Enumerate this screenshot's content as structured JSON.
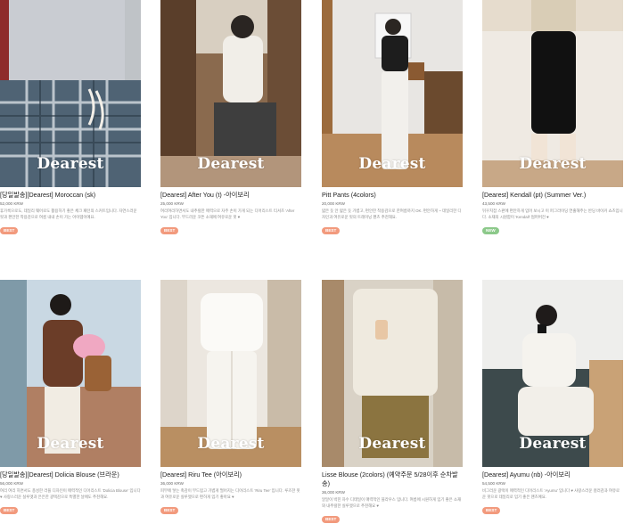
{
  "brand_wordmark": "Dearest",
  "products": [
    {
      "name": "[당일발송][Dearest] Moroccan (sk)",
      "price": "52,000 KRW",
      "desc": "휴가룩으로도, 데일리 웨어로도 활용하기 좋은 체크 패턴의 스커트입니다. 자연스러운 핏과 편안한 착용감으로 여름 내내 손이 가는 아이템이에요.",
      "badge": "BEST",
      "badge_color": "#f29a7d"
    },
    {
      "name": "[Dearest] After You (t) -아이보리",
      "price": "25,000 KRW",
      "desc": "여리여리하면서도 내추럴한 매력으로 자주 손이 가게 되는 디어리스트 티셔츠 'After You' 입니다. 부드러운 코튼 소재에 여유로운 핏 ♥",
      "badge": "BEST",
      "badge_color": "#f29a7d"
    },
    {
      "name": "Pitt Pants (4colors)",
      "price": "20,000 KRW",
      "desc": "얇은 듯 안 얇은 듯 가볍고, 편안한 착용감으로 한여름까지 OK. 편안하게 ~ 데일리한 디자인과 여유로운 핏의 트레이닝 팬츠 추천해요.",
      "badge": "BEST",
      "badge_color": "#f29a7d"
    },
    {
      "name": "[Dearest] Kendall (pt) (Summer Ver.)",
      "price": "43,500 KRW",
      "desc": "뒤꾸치잡 스판에 편안하게 입어 보시고 이 퍼그라이딩 연출해주는 반딩 바이커 쇼츠입니다. 소재의 시원함이 'Kendall' 썸머버전 ♥",
      "badge": "NEW",
      "badge_color": "#8cc98a"
    },
    {
      "name": "[당일발송][Dearest] Dolicia Blouse (브라운)",
      "price": "56,000 KRW",
      "desc": "여리 여리 하면서도 풍성한 러플 디자인이 매력적인 디어리스트 'Dolicia Blouse' 입니다 ♥ 사랑스러운 실루엣과 은은한 광택감으로 특별한 날에도 추천해요.",
      "badge": "BEST",
      "badge_color": "#f29a7d"
    },
    {
      "name": "[Dearest] Riru Tee (아이보리)",
      "price": "36,000 KRW",
      "desc": "피부에 닿는 촉감이 부드럽고 가볍게 떨어지는 디어리스트 'Riru Tee' 입니다. 루즈한 핏과 여유로운 실루엣으로 편하게 입기 좋아요 ♥",
      "badge": "BEST",
      "badge_color": "#f29a7d"
    },
    {
      "name": "Lisse Blouse (2colors) (예약주문 5/28이후 순차발송)",
      "price": "36,000 KRW",
      "desc": "알알이 박힌 자수 디테일이 매력적인 블라우스 입니다. 여름에 시원하게 입기 좋은 소재와 내추럴한 실루엣으로 추천해요 ♥",
      "badge": "BEST",
      "badge_color": "#f29a7d"
    },
    {
      "name": "[Dearest] Ayumu (nb) -아이보리",
      "price": "54,500 KRW",
      "desc": "비그러운 광택이 매력적인 디어리스트 'Ayumu' 입니다 ♥ 사랑스러운 컬러감과 여유로운 핏으로 데일리로 입기 좋은 팬츠예요.",
      "badge": "BEST",
      "badge_color": "#f29a7d"
    }
  ]
}
